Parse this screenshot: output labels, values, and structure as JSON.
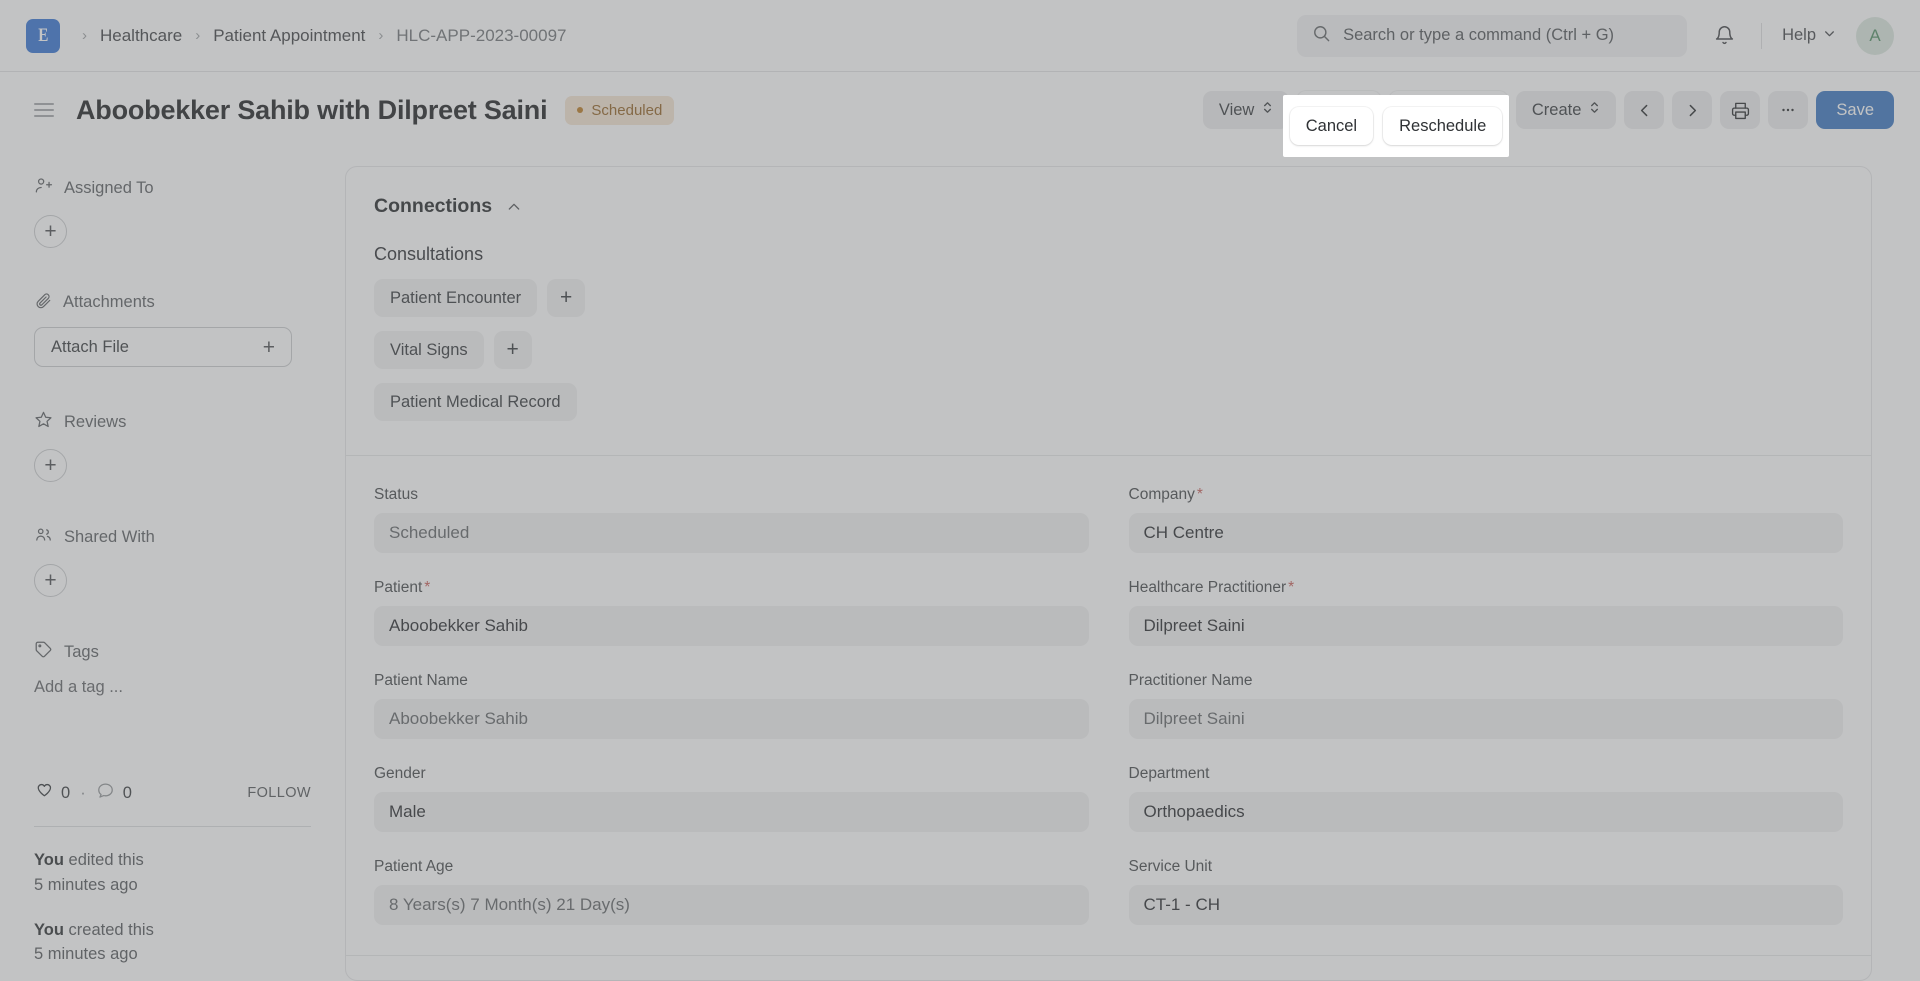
{
  "navbar": {
    "logo_letter": "E",
    "breadcrumbs": [
      {
        "label": "Healthcare",
        "muted": false
      },
      {
        "label": "Patient Appointment",
        "muted": false
      },
      {
        "label": "HLC-APP-2023-00097",
        "muted": true
      }
    ],
    "separator": "›",
    "search": {
      "placeholder": "Search or type a command (Ctrl + G)",
      "value": "",
      "icon": "search-icon"
    },
    "notification_icon": "bell-icon",
    "help_label": "Help",
    "help_chevron": "chevron-down-icon",
    "avatar_initial": "A"
  },
  "titlebar": {
    "menu_icon": "hamburger-icon",
    "title": "Aboobekker Sahib with Dilpreet Saini",
    "status": {
      "label": "Scheduled",
      "color": "#8f5c1a",
      "bg": "#f4e3cf"
    },
    "actions": {
      "view_label": "View",
      "cancel_label": "Cancel",
      "reschedule_label": "Reschedule",
      "create_label": "Create",
      "prev_icon": "chevron-left-icon",
      "next_icon": "chevron-right-icon",
      "print_icon": "printer-icon",
      "more_icon": "ellipsis-icon",
      "save_label": "Save",
      "save_color": "#3270bd"
    }
  },
  "sidebar": {
    "assigned_to": {
      "title": "Assigned To",
      "icon": "user-plus-icon",
      "add_icon": "plus-icon"
    },
    "attachments": {
      "title": "Attachments",
      "icon": "paperclip-icon",
      "button_label": "Attach File",
      "add_icon": "plus-icon"
    },
    "reviews": {
      "title": "Reviews",
      "icon": "star-icon",
      "add_icon": "plus-icon"
    },
    "shared_with": {
      "title": "Shared With",
      "icon": "users-icon",
      "add_icon": "plus-icon"
    },
    "tags": {
      "title": "Tags",
      "icon": "tag-icon",
      "placeholder": "Add a tag ..."
    },
    "meta": {
      "like_icon": "heart-icon",
      "like_count": "0",
      "dot": "·",
      "comment_icon": "comment-icon",
      "comment_count": "0",
      "follow_label": "FOLLOW"
    },
    "activity": [
      {
        "actor": "You",
        "action": " edited this",
        "time": "5 minutes ago"
      },
      {
        "actor": "You",
        "action": " created this",
        "time": "5 minutes ago"
      }
    ]
  },
  "main": {
    "section_title": "Connections",
    "collapse_icon": "chevron-up-icon",
    "subsection_title": "Consultations",
    "connection_rows": [
      {
        "label": "Patient Encounter",
        "has_add": true,
        "add_icon": "plus-icon"
      },
      {
        "label": "Vital Signs",
        "has_add": true,
        "add_icon": "plus-icon"
      },
      {
        "label": "Patient Medical Record",
        "has_add": false,
        "add_icon": ""
      }
    ],
    "fields": [
      {
        "label": "Status",
        "required": false,
        "value": "Scheduled",
        "readonly": true
      },
      {
        "label": "Company",
        "required": true,
        "value": "CH Centre",
        "readonly": false
      },
      {
        "label": "Patient",
        "required": true,
        "value": "Aboobekker Sahib",
        "readonly": false
      },
      {
        "label": "Healthcare Practitioner",
        "required": true,
        "value": "Dilpreet Saini",
        "readonly": false
      },
      {
        "label": "Patient Name",
        "required": false,
        "value": "Aboobekker Sahib",
        "readonly": true
      },
      {
        "label": "Practitioner Name",
        "required": false,
        "value": "Dilpreet Saini",
        "readonly": true
      },
      {
        "label": "Gender",
        "required": false,
        "value": "Male",
        "readonly": false
      },
      {
        "label": "Department",
        "required": false,
        "value": "Orthopaedics",
        "readonly": false
      },
      {
        "label": "Patient Age",
        "required": false,
        "value": "8 Years(s) 7 Month(s) 21 Day(s)",
        "readonly": true
      },
      {
        "label": "Service Unit",
        "required": false,
        "value": "CT-1 - CH",
        "readonly": false
      }
    ]
  }
}
